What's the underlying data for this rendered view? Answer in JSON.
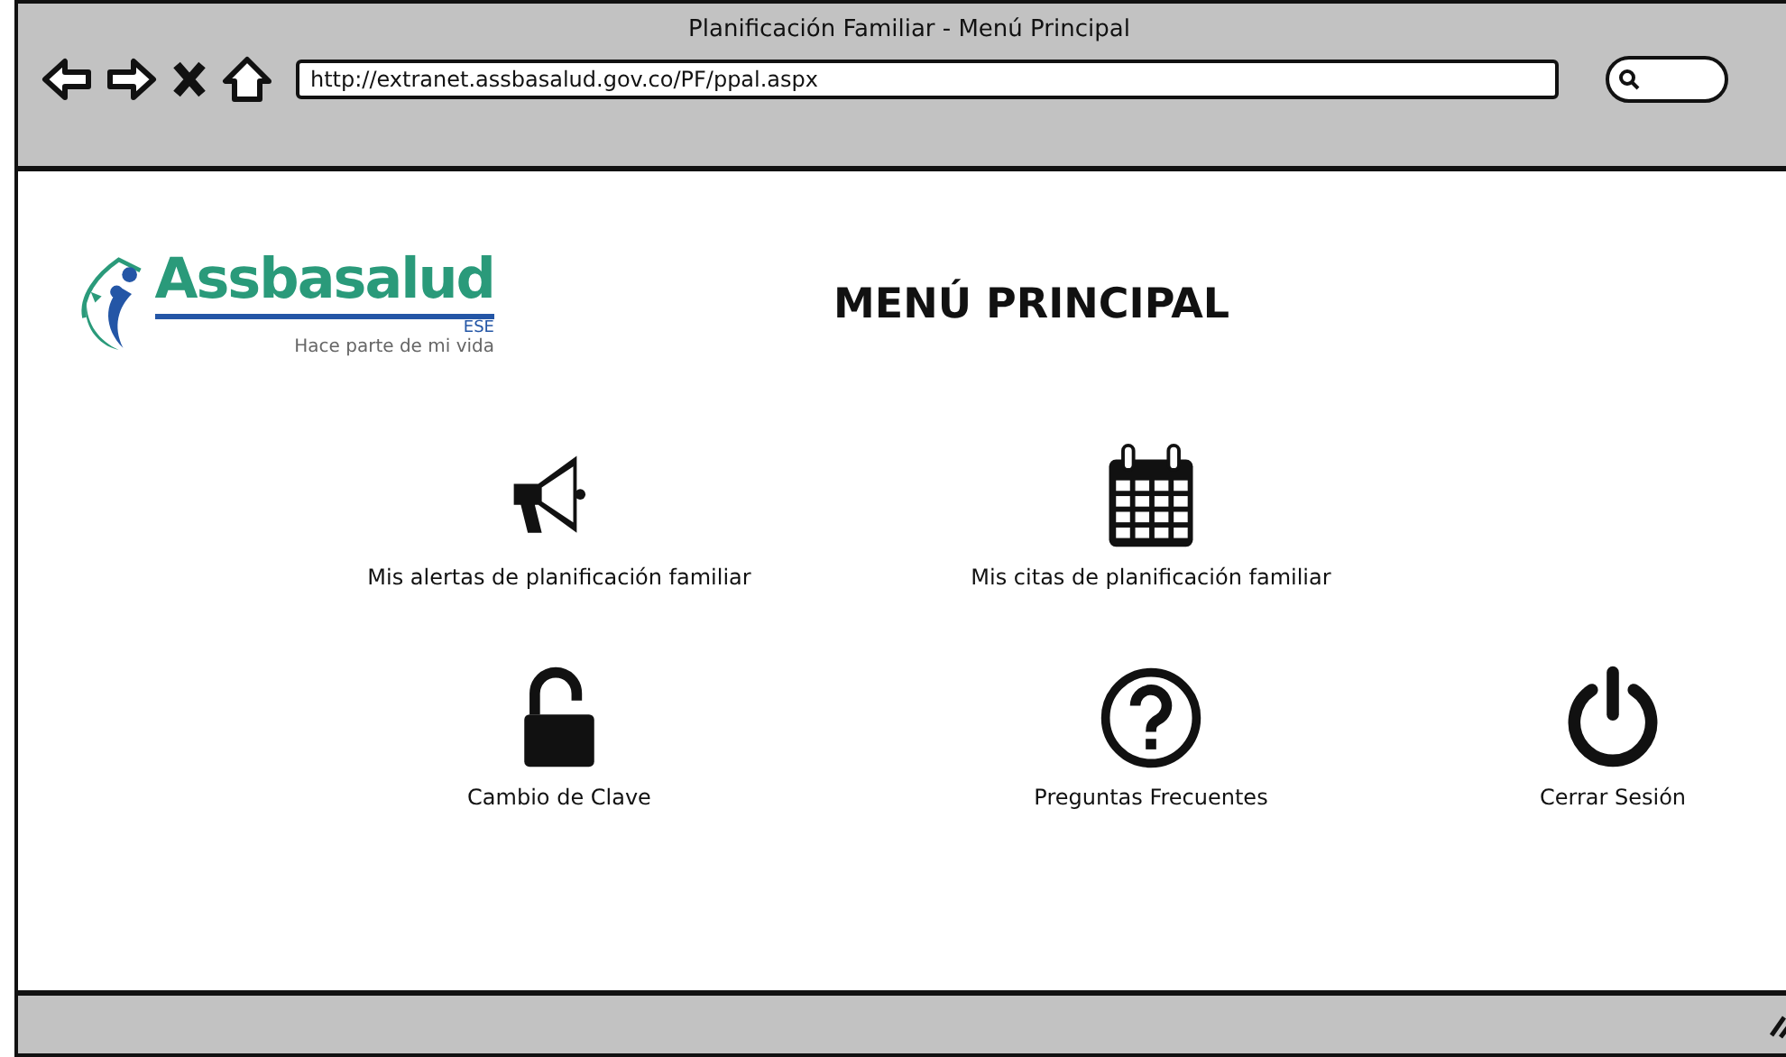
{
  "window": {
    "title": "Planificación Familiar - Menú Principal"
  },
  "address_bar": {
    "url": "http://extranet.assbasalud.gov.co/PF/ppal.aspx"
  },
  "logo": {
    "name": "Assbasalud",
    "suffix": "ESE",
    "tagline": "Hace parte de mi vida"
  },
  "heading": "MENÚ PRINCIPAL",
  "menu_rows": [
    [
      {
        "label": "Mis alertas de planificación familiar",
        "kind": "megaphone"
      },
      {
        "label": "Mis citas de planificación familiar",
        "kind": "calendar"
      }
    ],
    [
      {
        "label": "Cambio de Clave",
        "kind": "lock"
      },
      {
        "label": "Preguntas Frecuentes",
        "kind": "question"
      },
      {
        "label": "Cerrar Sesión",
        "kind": "power"
      }
    ]
  ]
}
